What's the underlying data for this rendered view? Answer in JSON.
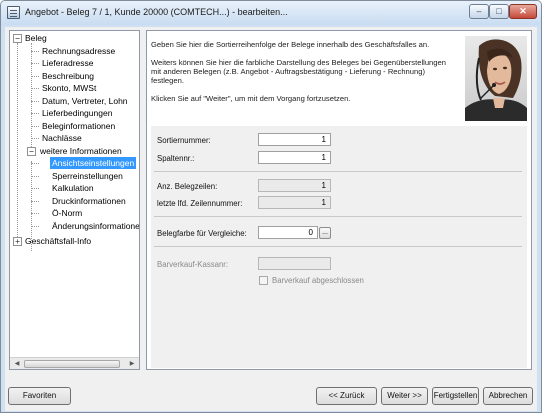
{
  "window": {
    "title": "Angebot - Beleg 7 / 1, Kunde 20000 (COMTECH...) - bearbeiten...",
    "min_symbol": "‒",
    "max_symbol": "□",
    "close_symbol": "✕"
  },
  "tree": {
    "root": {
      "label": "Beleg",
      "expander": "−"
    },
    "items": [
      {
        "label": "Rechnungsadresse"
      },
      {
        "label": "Lieferadresse"
      },
      {
        "label": "Beschreibung"
      },
      {
        "label": "Skonto, MWSt"
      },
      {
        "label": "Datum, Vertreter, Lohn"
      },
      {
        "label": "Lieferbedingungen"
      },
      {
        "label": "Beleginformationen"
      },
      {
        "label": "Nachlässe"
      }
    ],
    "weitere": {
      "label": "weitere Informationen",
      "expander": "−"
    },
    "sub_items": [
      {
        "label": "Ansichtseinstellungen",
        "selected": true
      },
      {
        "label": "Sperreinstellungen"
      },
      {
        "label": "Kalkulation"
      },
      {
        "label": "Druckinformationen"
      },
      {
        "label": "Ö-Norm"
      },
      {
        "label": "Änderungsinformatione"
      }
    ],
    "geschaeftsfall": {
      "label": "Geschäftsfall-Info",
      "expander": "+"
    },
    "scroll_left": "◀",
    "scroll_right": "▶"
  },
  "info": {
    "paragraph1": "Geben Sie hier die Sortierreihenfolge der Belege innerhalb des Geschäftsfalles an.",
    "paragraph2": "Weiters können Sie hier die farbliche Darstellung des Beleges bei Gegenüberstellungen mit anderen Belegen (z.B. Angebot - Auftragsbestätigung - Lieferung - Rechnung) festlegen.",
    "paragraph3": "Klicken Sie auf \"Weiter\", um mit dem Vorgang fortzusetzen."
  },
  "form": {
    "sortiernummer_label": "Sortiernummer:",
    "sortiernummer_value": "1",
    "spaltennr_label": "Spaltennr.:",
    "spaltennr_value": "1",
    "anz_belegzeilen_label": "Anz. Belegzeilen:",
    "anz_belegzeilen_value": "1",
    "letzte_zeile_label": "letzte lfd. Zeilennummer:",
    "letzte_zeile_value": "1",
    "belegfarbe_label": "Belegfarbe für Vergleiche:",
    "belegfarbe_value": "0",
    "belegfarbe_button": "...",
    "barverkauf_kassa_label": "Barverkauf-Kassanr:",
    "barverkauf_kassa_value": "",
    "barverkauf_abgeschlossen_label": "Barverkauf abgeschlossen",
    "barverkauf_abgeschlossen_checked": false
  },
  "buttons": {
    "favoriten": "Favoriten",
    "zurueck": "<< Zurück",
    "weiter": "Weiter >>",
    "fertigstellen": "Fertigstellen",
    "abbrechen": "Abbrechen"
  }
}
